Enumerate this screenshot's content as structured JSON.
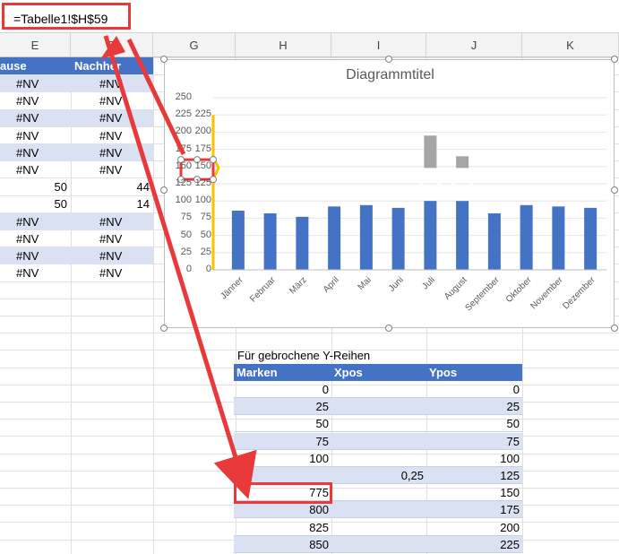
{
  "formula": {
    "text": "=Tabelle1!$H$59"
  },
  "columns": [
    "E",
    "F",
    "G",
    "H",
    "I",
    "J",
    "K"
  ],
  "left_table": {
    "header": [
      "ause",
      "Nachher"
    ],
    "rows": [
      [
        "#NV",
        "#NV"
      ],
      [
        "#NV",
        "#NV"
      ],
      [
        "#NV",
        "#NV"
      ],
      [
        "#NV",
        "#NV"
      ],
      [
        "#NV",
        "#NV"
      ],
      [
        "#NV",
        "#NV"
      ],
      [
        "50",
        "44"
      ],
      [
        "50",
        "14"
      ],
      [
        "#NV",
        "#NV"
      ],
      [
        "#NV",
        "#NV"
      ],
      [
        "#NV",
        "#NV"
      ],
      [
        "#NV",
        "#NV"
      ]
    ]
  },
  "chart_data": {
    "type": "bar",
    "title": "Diagrammtitel",
    "categories": [
      "Jänner",
      "Februar",
      "März",
      "April",
      "Mai",
      "Juni",
      "Juli",
      "August",
      "September",
      "Oktober",
      "November",
      "Dezember"
    ],
    "values": [
      86,
      82,
      77,
      92,
      94,
      90,
      100,
      100,
      82,
      94,
      92,
      90
    ],
    "broken_upper_values": [
      null,
      null,
      null,
      null,
      null,
      null,
      195,
      165,
      null,
      null,
      null,
      null
    ],
    "ylim": [
      0,
      250
    ],
    "yticks": [
      "250",
      "225",
      "200",
      "175",
      "150",
      "125",
      "100",
      "75",
      "50",
      "25",
      "0"
    ],
    "yticks_secondary": [
      "225",
      "200",
      "175",
      "150",
      "125",
      "100",
      "75",
      "50",
      "25",
      "0"
    ],
    "colors": {
      "series": "#4472c4",
      "broken": "#a5a5a5",
      "axis_marker": "#ffc000"
    }
  },
  "bottom_table": {
    "caption": "Für gebrochene Y-Reihen",
    "headers": [
      "Marken",
      "Xpos",
      "Ypos"
    ],
    "rows": [
      [
        "0",
        "",
        "0"
      ],
      [
        "25",
        "",
        "25"
      ],
      [
        "50",
        "",
        "50"
      ],
      [
        "75",
        "",
        "75"
      ],
      [
        "100",
        "",
        "100"
      ],
      [
        "",
        "0,25",
        "125"
      ],
      [
        "775",
        "",
        "150"
      ],
      [
        "800",
        "",
        "175"
      ],
      [
        "825",
        "",
        "200"
      ],
      [
        "850",
        "",
        "225"
      ]
    ]
  },
  "colors": {
    "header_blue": "#4472c4",
    "band": "#d9e1f2",
    "highlight_red": "#e8393b"
  }
}
